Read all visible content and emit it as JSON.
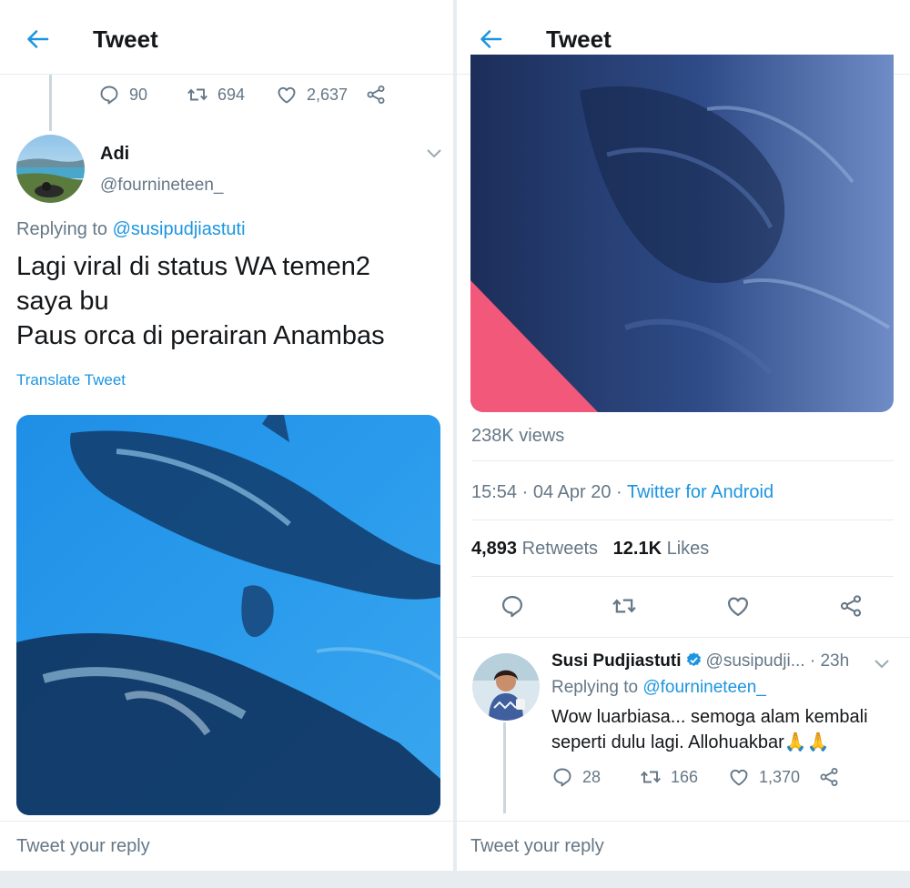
{
  "header_title": "Tweet",
  "left": {
    "parent_actions": {
      "replies": "90",
      "retweets": "694",
      "likes": "2,637"
    },
    "tweet": {
      "name": "Adi",
      "handle": "@fournineteen_",
      "replying_prefix": "Replying to",
      "replying_to": "@susipudjiastuti",
      "text_lines": [
        "Lagi viral di status WA temen2",
        "saya bu",
        "Paus orca di perairan Anambas"
      ],
      "translate": "Translate Tweet"
    },
    "reply_placeholder": "Tweet your reply"
  },
  "right": {
    "views": "238K views",
    "time": "15:54",
    "date": "04 Apr 20",
    "dot": "·",
    "source": "Twitter for Android",
    "retweets_count": "4,893",
    "retweets_label": "Retweets",
    "likes_count": "12.1K",
    "likes_label": "Likes",
    "reply": {
      "name": "Susi Pudjiastuti",
      "handle": "@susipudji...",
      "time": "· 23h",
      "replying_prefix": "Replying to",
      "replying_to": "@fournineteen_",
      "text_line1": "Wow luarbiasa... semoga alam kembali",
      "text_line2": "seperti dulu lagi. Allohuakbar",
      "emoji": "🙏🙏",
      "replies": "28",
      "retweets": "166",
      "likes": "1,370"
    },
    "reply_placeholder": "Tweet your reply"
  },
  "icons": {
    "back": "arrow-left-icon",
    "reply": "speech-bubble-icon",
    "retweet": "retweet-icon",
    "like": "heart-icon",
    "share": "share-icon",
    "caret": "chevron-down-icon",
    "verified": "verified-badge-icon"
  },
  "colors": {
    "accent": "#1b95e0",
    "muted": "#657786",
    "border": "#e6ecf0"
  }
}
